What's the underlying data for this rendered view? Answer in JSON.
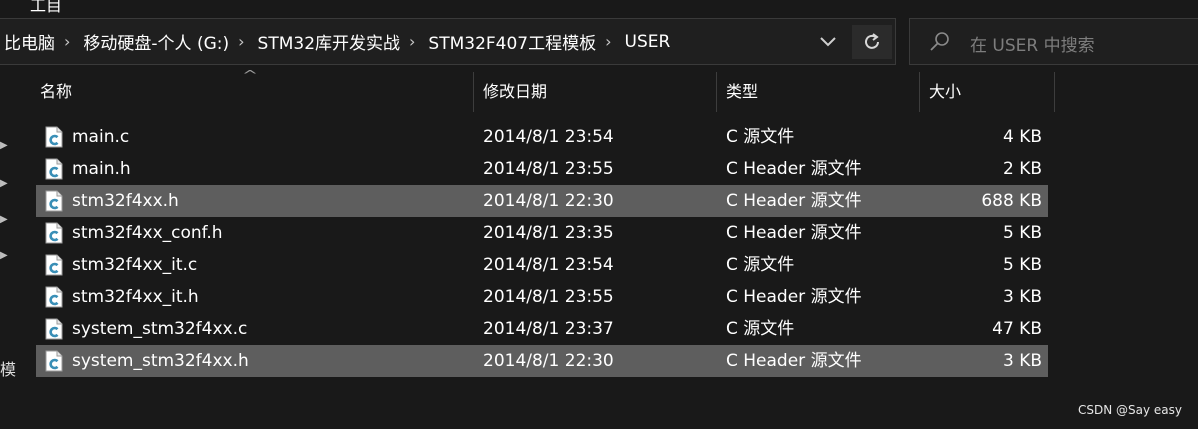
{
  "title_fragment": "工目",
  "breadcrumb": {
    "items": [
      "比电脑",
      "移动硬盘-个人 (G:)",
      "STM32库开发实战",
      "STM32F407工程模板",
      "USER"
    ],
    "separator": "›"
  },
  "search": {
    "placeholder": "在 USER 中搜索"
  },
  "nav_fragment": "模",
  "columns": {
    "name": "名称",
    "date": "修改日期",
    "type": "类型",
    "size": "大小"
  },
  "files": [
    {
      "name": "main.c",
      "date": "2014/8/1 23:54",
      "type": "C 源文件",
      "size": "4 KB",
      "selected": false
    },
    {
      "name": "main.h",
      "date": "2014/8/1 23:55",
      "type": "C Header 源文件",
      "size": "2 KB",
      "selected": false
    },
    {
      "name": "stm32f4xx.h",
      "date": "2014/8/1 22:30",
      "type": "C Header 源文件",
      "size": "688 KB",
      "selected": true
    },
    {
      "name": "stm32f4xx_conf.h",
      "date": "2014/8/1 23:35",
      "type": "C Header 源文件",
      "size": "5 KB",
      "selected": false
    },
    {
      "name": "stm32f4xx_it.c",
      "date": "2014/8/1 23:54",
      "type": "C 源文件",
      "size": "5 KB",
      "selected": false
    },
    {
      "name": "stm32f4xx_it.h",
      "date": "2014/8/1 23:55",
      "type": "C Header 源文件",
      "size": "3 KB",
      "selected": false
    },
    {
      "name": "system_stm32f4xx.c",
      "date": "2014/8/1 23:37",
      "type": "C 源文件",
      "size": "47 KB",
      "selected": false
    },
    {
      "name": "system_stm32f4xx.h",
      "date": "2014/8/1 22:30",
      "type": "C Header 源文件",
      "size": "3 KB",
      "selected": true
    }
  ],
  "watermark": "CSDN @Say easy",
  "colors": {
    "background": "#191919",
    "selected_row": "#5e5e5e",
    "icon_accent": "#3a8fb7"
  }
}
